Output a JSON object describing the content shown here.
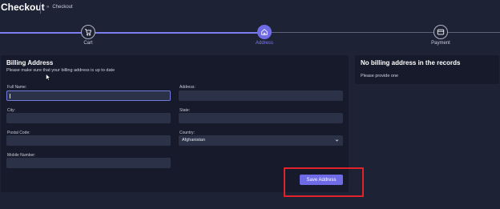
{
  "header": {
    "title": "Checkout",
    "breadcrumb_sep": "»",
    "breadcrumb": "Checkout"
  },
  "progress": {
    "fraction": 0.5,
    "steps": [
      {
        "label": "Cart",
        "icon": "cart-icon",
        "state": "done"
      },
      {
        "label": "Address",
        "icon": "home-icon",
        "state": "current"
      },
      {
        "label": "Payment",
        "icon": "card-icon",
        "state": "todo"
      }
    ]
  },
  "billing": {
    "title": "Billing Address",
    "subtitle": "Please make sure that your billing address is up to date",
    "fields": {
      "full_name": {
        "label": "Full Name:",
        "value": ""
      },
      "address": {
        "label": "Address:",
        "value": ""
      },
      "city": {
        "label": "City:",
        "value": ""
      },
      "state": {
        "label": "State:",
        "value": ""
      },
      "postal_code": {
        "label": "Postal Code:",
        "value": ""
      },
      "country": {
        "label": "Country:",
        "value": "Afghanistan"
      },
      "mobile": {
        "label": "Mobile Number:",
        "value": ""
      }
    },
    "save_label": "Save Address"
  },
  "records": {
    "title": "No billing address in the records",
    "message": "Please provide one"
  },
  "colors": {
    "accent": "#6f6be6",
    "highlight": "#e0222b",
    "background": "#1d2234",
    "panel": "#161a2b"
  }
}
